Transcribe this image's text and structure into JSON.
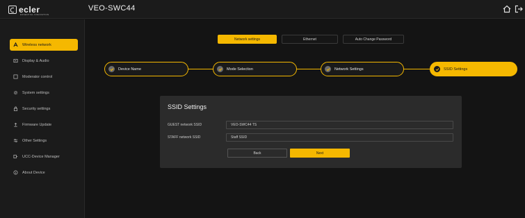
{
  "header": {
    "logo_text": "ecler",
    "logo_sub": "ESSENTIAL INNOVATION",
    "device_title": "VEO-SWC44"
  },
  "sidebar": {
    "items": [
      {
        "label": "Wireless network",
        "icon": "wireless-network-icon",
        "active": true
      },
      {
        "label": "Display & Audio",
        "icon": "display-icon",
        "active": false
      },
      {
        "label": "Moderator control",
        "icon": "moderator-icon",
        "active": false
      },
      {
        "label": "System settings",
        "icon": "gear-icon",
        "active": false
      },
      {
        "label": "Security settings",
        "icon": "lock-icon",
        "active": false
      },
      {
        "label": "Firmware Update",
        "icon": "upload-icon",
        "active": false
      },
      {
        "label": "Other Settings",
        "icon": "sliders-icon",
        "active": false
      },
      {
        "label": "UCC-Device Manager",
        "icon": "device-manager-icon",
        "active": false
      },
      {
        "label": "About Device",
        "icon": "info-icon",
        "active": false
      }
    ]
  },
  "tabs": [
    {
      "label": "Network settings",
      "active": true
    },
    {
      "label": "Ethernet",
      "active": false
    },
    {
      "label": "Auto Change Password",
      "active": false
    }
  ],
  "steps": [
    {
      "label": "Device Name",
      "done": true
    },
    {
      "label": "Mode Selection",
      "done": true
    },
    {
      "label": "Network Settings",
      "done": true
    },
    {
      "label": "SSID Settings",
      "current": true
    }
  ],
  "panel": {
    "title": "SSID Settings",
    "guest_label": "GUEST network SSID",
    "guest_value": "VEO-SWC44 TS",
    "staff_label": "STAFF network SSID",
    "staff_value": "Staff SSID",
    "back_label": "Back",
    "next_label": "Next"
  },
  "colors": {
    "accent": "#f5b800",
    "background": "#141414",
    "panel": "#2b2b2b"
  }
}
